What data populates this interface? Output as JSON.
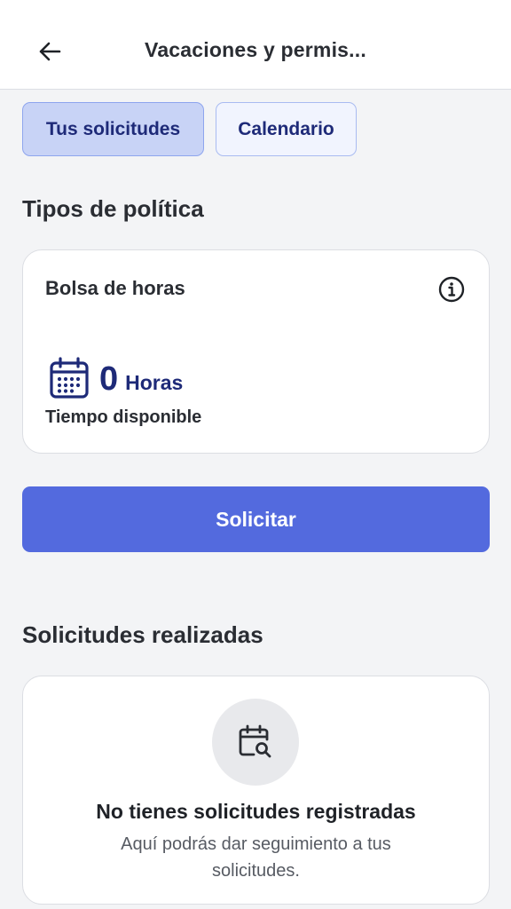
{
  "header": {
    "title": "Vacaciones y permis...",
    "back_icon": "arrow-left-icon"
  },
  "tabs": [
    {
      "label": "Tus solicitudes",
      "active": true
    },
    {
      "label": "Calendario",
      "active": false
    }
  ],
  "policy_section": {
    "title": "Tipos de política",
    "card": {
      "name": "Bolsa de horas",
      "info_icon": "info-icon",
      "calendar_icon": "calendar-icon",
      "hours_value": "0",
      "hours_unit": "Horas",
      "availability_label": "Tiempo disponible"
    }
  },
  "request_button": {
    "label": "Solicitar"
  },
  "requests_section": {
    "title": "Solicitudes realizadas",
    "empty_state": {
      "icon": "calendar-search-icon",
      "title": "No tienes solicitudes registradas",
      "description": "Aquí podrás dar seguimiento a tus solicitudes."
    }
  },
  "colors": {
    "accent": "#536ade",
    "accent_dark": "#1e2a78",
    "tab_active_bg": "#c8d3f6",
    "background": "#f3f4f6"
  }
}
